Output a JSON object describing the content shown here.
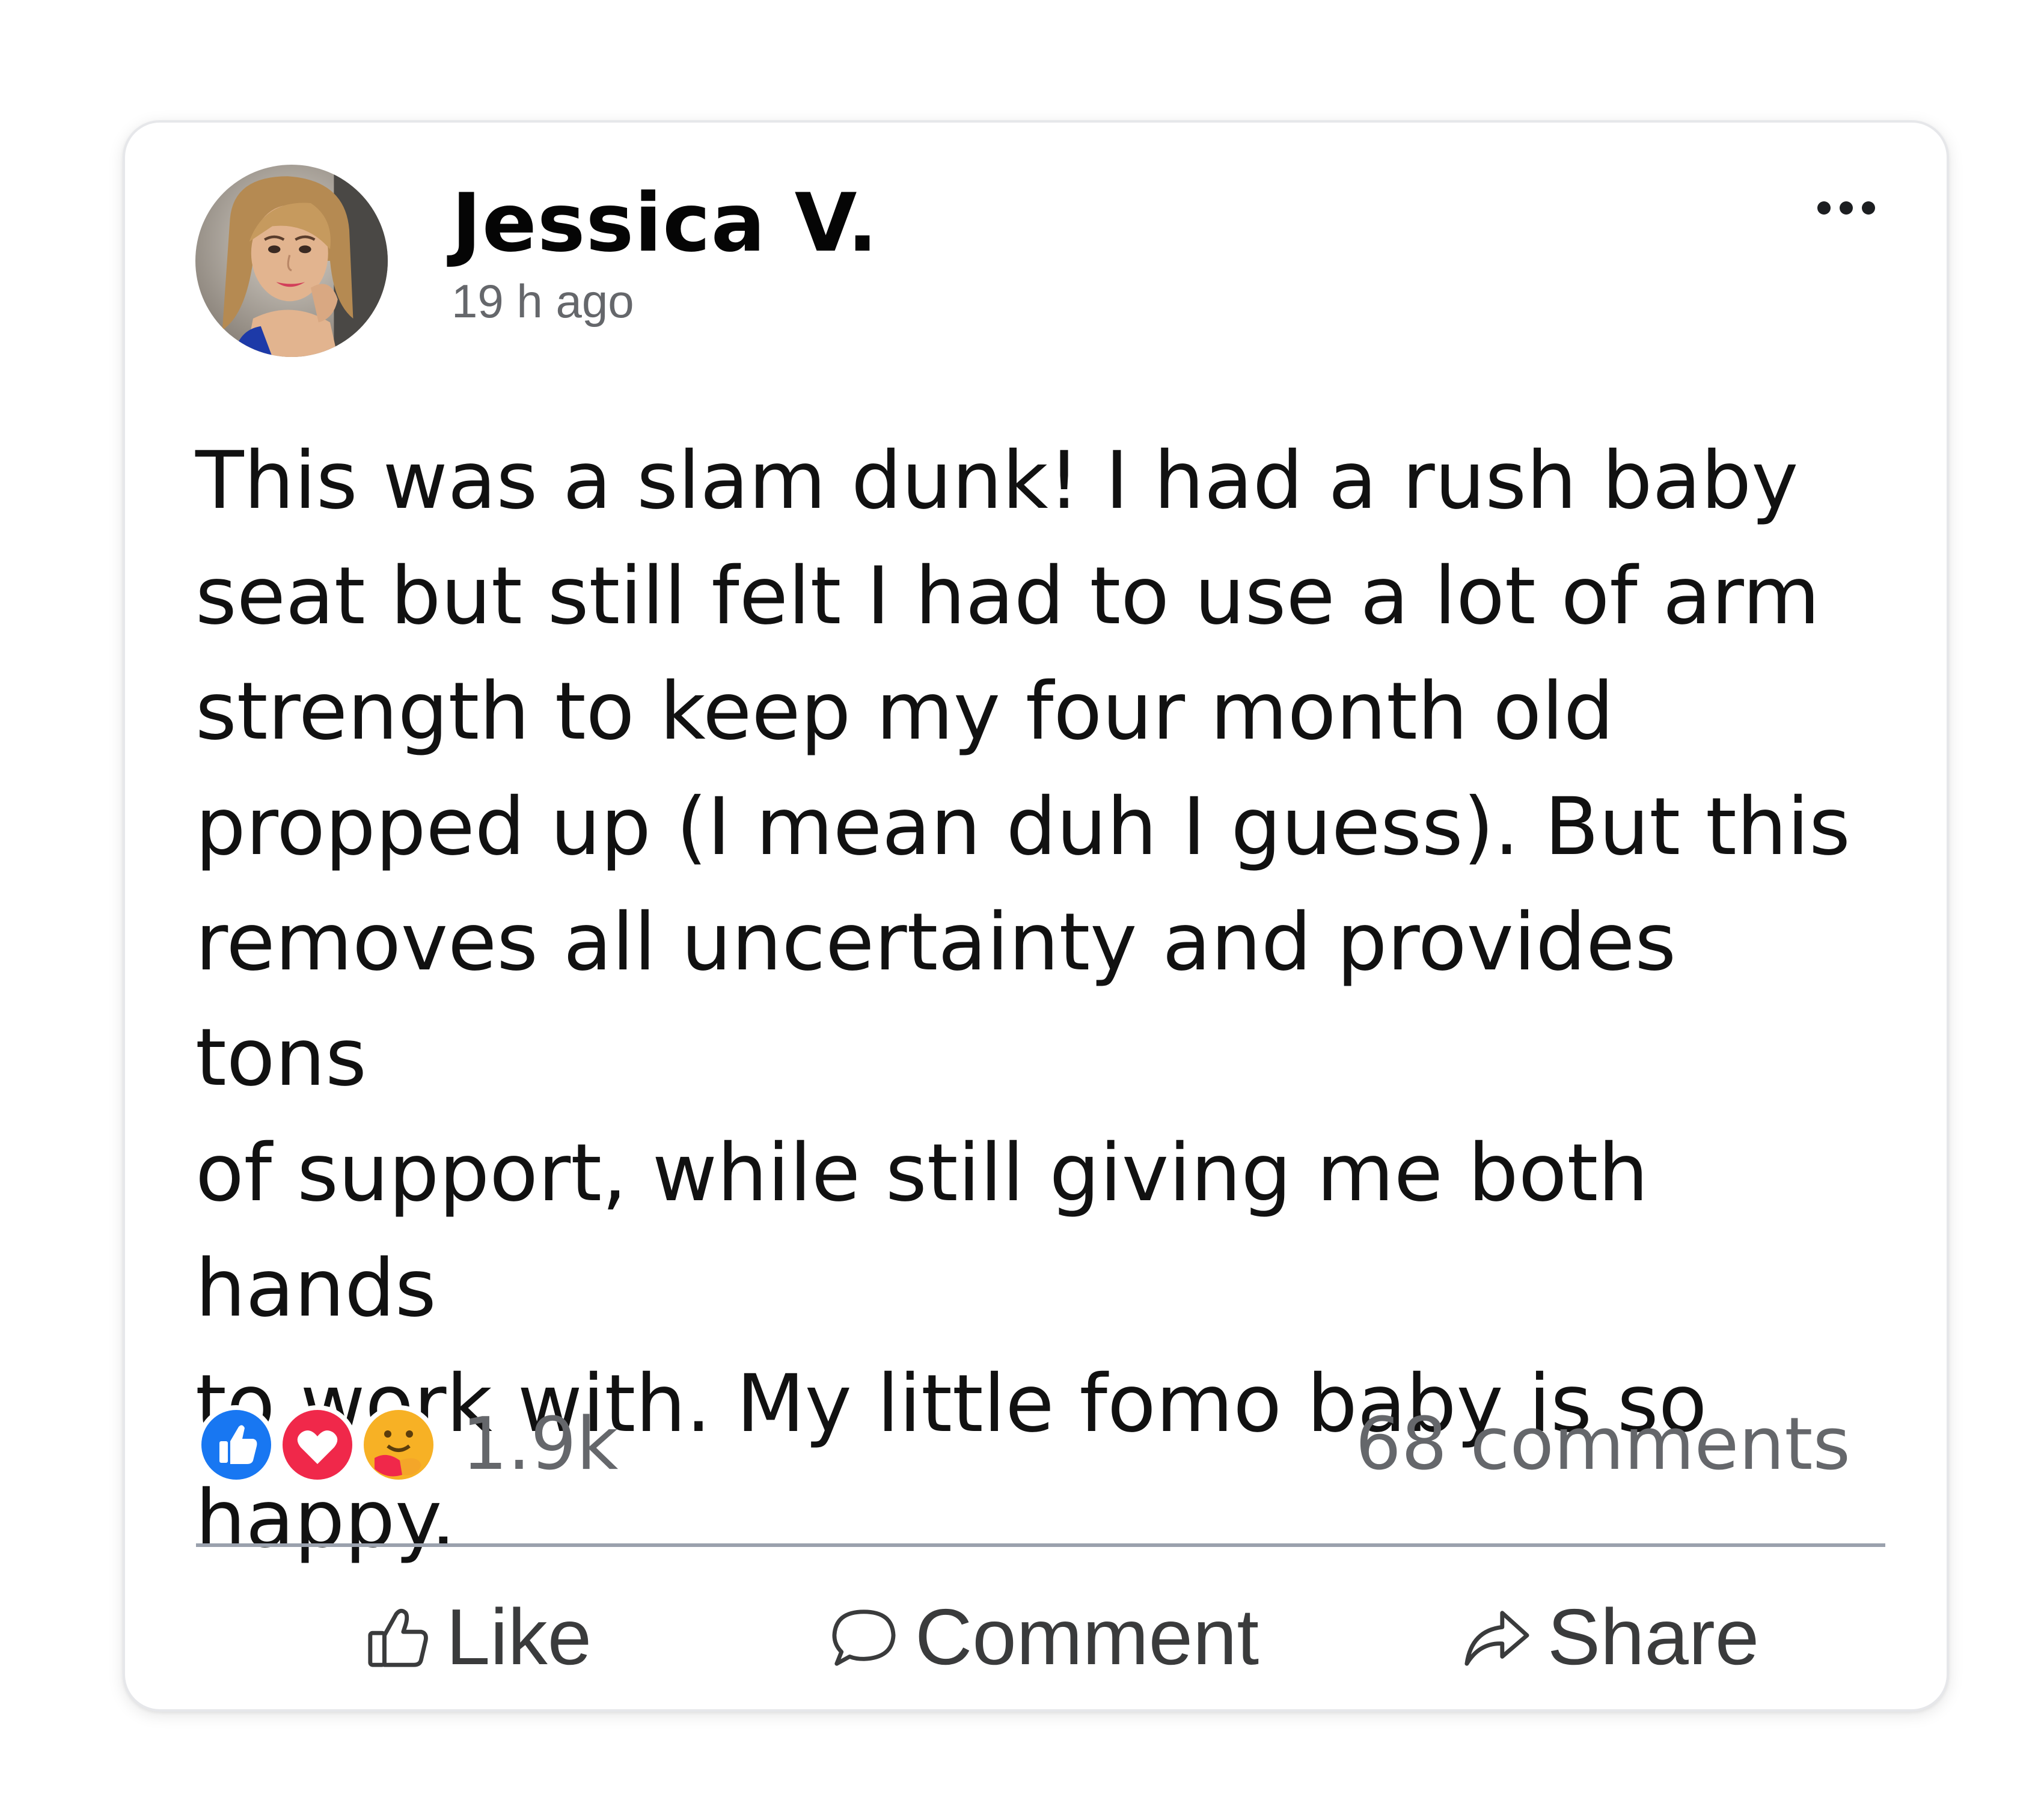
{
  "post": {
    "author": {
      "name": "Jessica V.",
      "avatar_icon": "avatar-photo"
    },
    "timestamp": "19 h ago",
    "more_icon": "more-dots-icon",
    "text": "This was a slam dunk! I had a rush baby\nseat but still felt I had to use a lot of arm\nstrength to keep my four month old\npropped up (I mean duh I guess). But this\nremoves all uncertainty and provides tons\nof support, while still giving me both hands\nto work with. My little fomo baby is so\nhappy.",
    "reactions": {
      "icons": [
        "like-icon",
        "love-icon",
        "care-icon"
      ],
      "count": "1.9k"
    },
    "comments_count": "68 comments",
    "actions": {
      "like": "Like",
      "comment": "Comment",
      "share": "Share"
    }
  },
  "colors": {
    "text_primary": "#050505",
    "text_secondary": "#65676b",
    "like_blue": "#1877f2",
    "love_red": "#f0284a",
    "care_yellow": "#f7b125",
    "divider": "#9aa1ad"
  }
}
